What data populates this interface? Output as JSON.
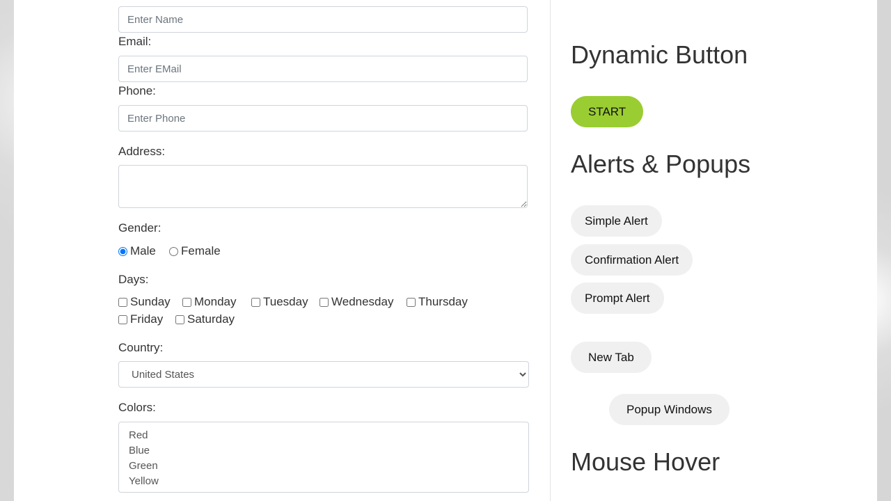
{
  "form": {
    "name_placeholder": "Enter Name",
    "email_label": "Email:",
    "email_placeholder": "Enter EMail",
    "phone_label": "Phone:",
    "phone_placeholder": "Enter Phone",
    "address_label": "Address:",
    "gender_label": "Gender:",
    "genders": [
      {
        "label": "Male",
        "checked": true
      },
      {
        "label": "Female",
        "checked": false
      }
    ],
    "days_label": "Days:",
    "days": [
      "Sunday",
      "Monday",
      "Tuesday",
      "Wednesday",
      "Thursday",
      "Friday",
      "Saturday"
    ],
    "country_label": "Country:",
    "country_value": "United States",
    "colors_label": "Colors:",
    "colors": [
      "Red",
      "Blue",
      "Green",
      "Yellow"
    ]
  },
  "sidebar": {
    "dynamic_title": "Dynamic Button",
    "start_label": "START",
    "start_color": "#9acd32",
    "alerts_title": "Alerts & Popups",
    "simple_alert": "Simple Alert",
    "confirmation_alert": "Confirmation Alert",
    "prompt_alert": "Prompt Alert",
    "new_tab": "New Tab",
    "popup_windows": "Popup Windows",
    "mouse_hover_title": "Mouse Hover"
  }
}
